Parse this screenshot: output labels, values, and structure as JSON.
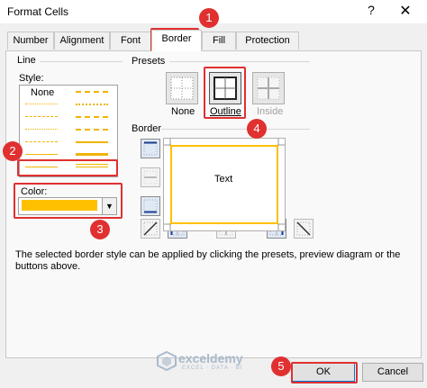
{
  "window": {
    "title": "Format Cells",
    "help_label": "?",
    "close_label": "✕"
  },
  "tabs": [
    {
      "label": "Number"
    },
    {
      "label": "Alignment"
    },
    {
      "label": "Font"
    },
    {
      "label": "Border",
      "active": true
    },
    {
      "label": "Fill"
    },
    {
      "label": "Protection"
    }
  ],
  "line": {
    "title": "Line",
    "style_label": "Style:",
    "style_none_label": "None",
    "color_label": "Color:",
    "color_value": "#ffc000"
  },
  "presets": {
    "title": "Presets",
    "items": [
      {
        "label": "None"
      },
      {
        "label": "Outline",
        "selected": true
      },
      {
        "label": "Inside",
        "disabled": true
      }
    ]
  },
  "border": {
    "title": "Border",
    "preview_text": "Text"
  },
  "description": "The selected border style can be applied by clicking the presets, preview diagram or the buttons above.",
  "watermark": {
    "name": "exceldemy",
    "tagline": "EXCEL · DATA · BI"
  },
  "footer": {
    "ok_label": "OK",
    "cancel_label": "Cancel"
  },
  "annotations": [
    "1",
    "2",
    "3",
    "4",
    "5"
  ],
  "colors": {
    "accent_border": "#ffc000",
    "annotation_red": "#e03030",
    "focus_blue": "#0078d7"
  }
}
